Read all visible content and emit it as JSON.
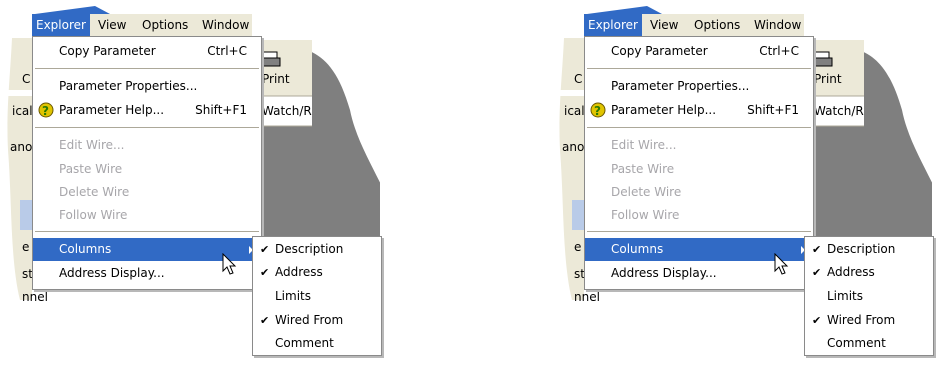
{
  "panels": [
    {
      "menubar": {
        "explorer": "Explorer",
        "view": "View",
        "options": "Options",
        "window": "Window"
      },
      "background": {
        "print_label": "Print",
        "watch_label": "Watch/R",
        "frag_c": "C",
        "frag_ical": "ical",
        "frag_ano": "ano",
        "frag_e": "e",
        "frag_st": "st",
        "frag_nnel": "nnel"
      },
      "menu": {
        "copy_parameter": "Copy Parameter",
        "copy_shortcut": "Ctrl+C",
        "parameter_properties": "Parameter Properties...",
        "parameter_help": "Parameter Help...",
        "help_shortcut": "Shift+F1",
        "edit_wire": "Edit Wire...",
        "paste_wire": "Paste Wire",
        "delete_wire": "Delete Wire",
        "follow_wire": "Follow Wire",
        "columns": "Columns",
        "address_display": "Address Display..."
      },
      "submenu": {
        "description": "Description",
        "address": "Address",
        "limits": "Limits",
        "wired_from": "Wired From",
        "comment": "Comment"
      }
    },
    {
      "menubar": {
        "explorer": "Explorer",
        "view": "View",
        "options": "Options",
        "window": "Window"
      },
      "background": {
        "print_label": "Print",
        "watch_label": "Watch/R",
        "frag_c": "C",
        "frag_ical": "ical",
        "frag_ano": "ano",
        "frag_e": "e",
        "frag_st": "st",
        "frag_nnel": "nnel"
      },
      "menu": {
        "copy_parameter": "Copy Parameter",
        "copy_shortcut": "Ctrl+C",
        "parameter_properties": "Parameter Properties...",
        "parameter_help": "Parameter Help...",
        "help_shortcut": "Shift+F1",
        "edit_wire": "Edit Wire...",
        "paste_wire": "Paste Wire",
        "delete_wire": "Delete Wire",
        "follow_wire": "Follow Wire",
        "columns": "Columns",
        "address_display": "Address Display..."
      },
      "submenu": {
        "description": "Description",
        "address": "Address",
        "limits": "Limits",
        "wired_from": "Wired From",
        "comment": "Comment"
      }
    }
  ],
  "colors": {
    "highlight": "#316ac5",
    "menubar": "#ece9d8",
    "workspace": "#7f7f7f",
    "disabled": "#a7a6aa"
  },
  "icons": {
    "help": "help-icon",
    "print": "printer-icon",
    "check": "checkmark-icon",
    "submenu_arrow": "chevron-right-icon",
    "cursor": "mouse-pointer-icon"
  }
}
